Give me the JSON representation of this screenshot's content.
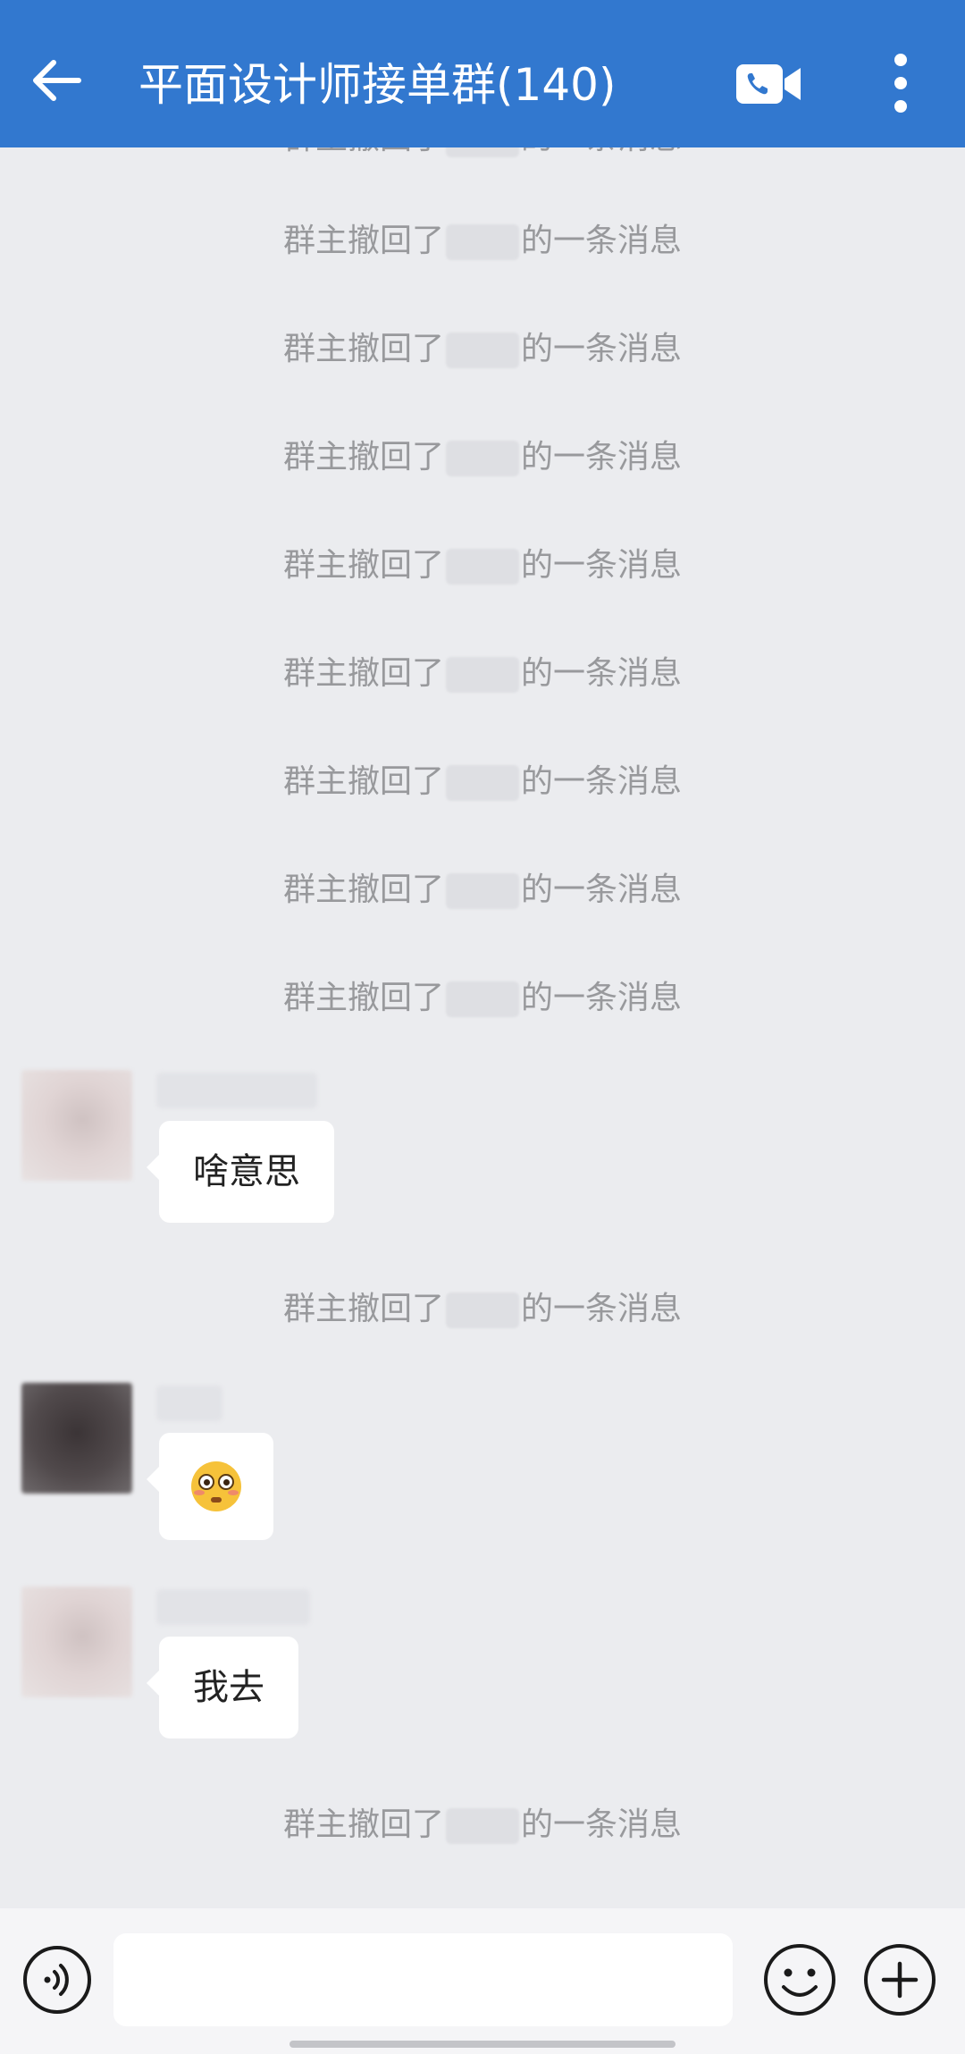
{
  "header": {
    "title": "平面设计师接单群(140)",
    "icons": [
      "back-arrow-icon",
      "video-call-icon",
      "more-vertical-icon"
    ],
    "background_color": "#3278cf"
  },
  "system_message": {
    "prefix": "群主撤回了",
    "suffix": "的一条消息"
  },
  "messages": [
    {
      "type": "system"
    },
    {
      "type": "system"
    },
    {
      "type": "system"
    },
    {
      "type": "system"
    },
    {
      "type": "system"
    },
    {
      "type": "system"
    },
    {
      "type": "system"
    },
    {
      "type": "system"
    },
    {
      "type": "system"
    },
    {
      "type": "chat",
      "text": "啥意思"
    },
    {
      "type": "system"
    },
    {
      "type": "chat",
      "emoji": "flushed-face-emoji"
    },
    {
      "type": "chat",
      "text": "我去"
    },
    {
      "type": "system"
    }
  ],
  "input_bar": {
    "value": "",
    "icons": [
      "voice-icon",
      "emoji-icon",
      "plus-icon"
    ]
  }
}
